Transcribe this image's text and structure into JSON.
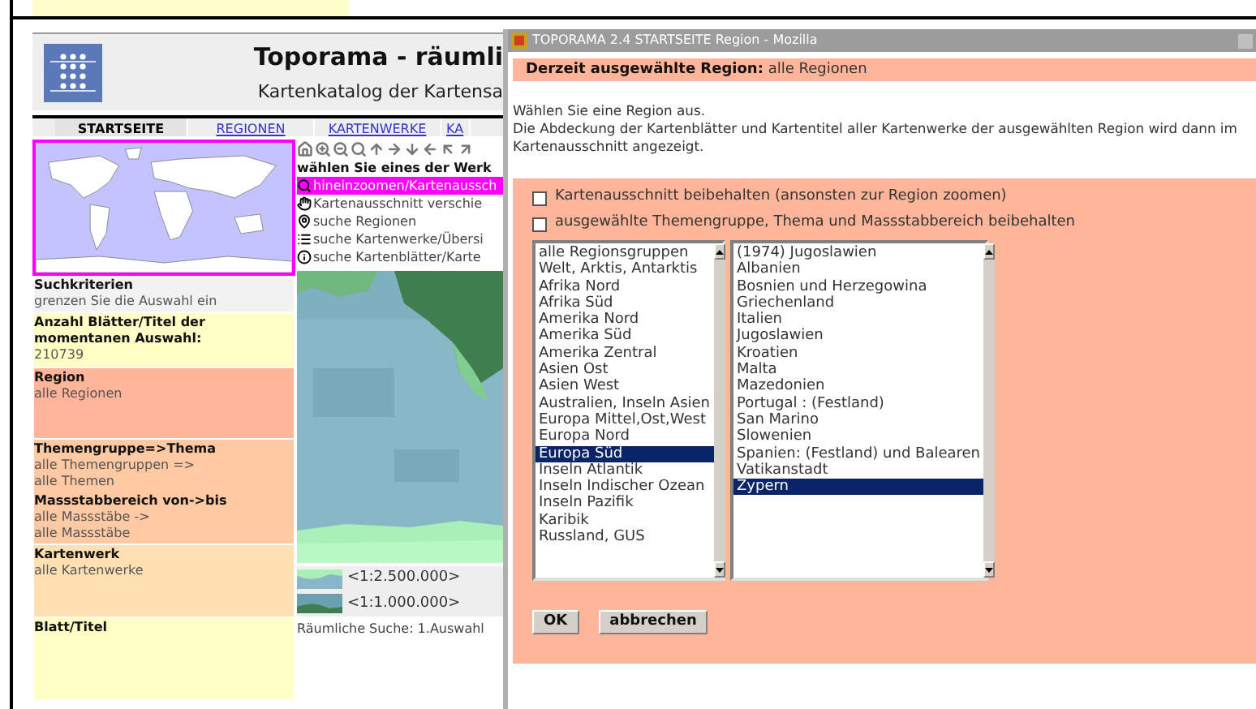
{
  "header": {
    "title": "Toporama - räumli",
    "subtitle": "Kartenkatalog der Kartensa"
  },
  "nav": [
    {
      "label": "STARTSEITE",
      "selected": true
    },
    {
      "label": "REGIONEN",
      "selected": false
    },
    {
      "label": "KARTENWERKE",
      "selected": false
    },
    {
      "label": "KA",
      "selected": false
    }
  ],
  "criteria": {
    "title": "Suchkriterien",
    "hint": "grenzen Sie die Auswahl ein",
    "count_label": "Anzahl Blätter/Titel der momentanen Auswahl:",
    "count": "210739",
    "sections": [
      {
        "color": "#ffb599",
        "items": [
          {
            "label": "Region",
            "values": [
              "alle Regionen"
            ]
          }
        ]
      },
      {
        "color": "#ffc9a3",
        "items": [
          {
            "label": "Themengruppe=>Thema",
            "values": [
              "alle Themengruppen =>",
              "alle Themen"
            ]
          },
          {
            "label": "Massstabbereich von->bis",
            "values": [
              "alle Massstäbe ->",
              "alle Massstäbe"
            ]
          }
        ]
      },
      {
        "color": "#ffe0b3",
        "items": [
          {
            "label": "Kartenwerk",
            "values": [
              "alle Kartenwerke"
            ]
          }
        ]
      },
      {
        "color": "#ffffc6",
        "items": [
          {
            "label": "Blatt/Titel"
          }
        ]
      }
    ]
  },
  "tools": {
    "heading": "wählen Sie eines der Werk",
    "items": [
      {
        "kind": "zoom",
        "label": "hineinzoomen/Kartenaussch",
        "selected": true
      },
      {
        "kind": "pan",
        "label": "Kartenausschnitt verschie",
        "selected": false
      },
      {
        "kind": "region",
        "label": "suche Regionen",
        "selected": false
      },
      {
        "kind": "list",
        "label": "suche Kartenwerke/Übersi",
        "selected": false
      },
      {
        "kind": "info",
        "label": "suche Kartenblätter/Karte",
        "selected": false
      }
    ]
  },
  "legend": [
    "<1:2.500.000>",
    "<1:1.000.000>"
  ],
  "map_status": "Räumliche Suche: 1.Auswahl",
  "dialog": {
    "title": "TOPORAMA 2.4 STARTSEITE Region - Mozilla",
    "current_label": "Derzeit ausgewählte Region:",
    "current_value": "alle Regionen",
    "intro": [
      "Wählen Sie eine Region aus.",
      "Die Abdeckung der Kartenblätter und Kartentitel aller Kartenwerke der ausgewählten Region wird dann im Kartenausschnitt angezeigt."
    ],
    "options": [
      {
        "label": "Kartenausschnitt beibehalten (ansonsten zur Region zoomen)",
        "checked": false
      },
      {
        "label": "ausgewählte Themengruppe, Thema und Massstabbereich beibehalten",
        "checked": false
      }
    ],
    "groups": [
      {
        "label": "alle Regionsgruppen",
        "selected": false
      },
      {
        "label": "Welt, Arktis, Antarktis",
        "selected": false
      },
      {
        "label": "Afrika Nord",
        "selected": false
      },
      {
        "label": "Afrika Süd",
        "selected": false
      },
      {
        "label": "Amerika Nord",
        "selected": false
      },
      {
        "label": "Amerika Süd",
        "selected": false
      },
      {
        "label": "Amerika Zentral",
        "selected": false
      },
      {
        "label": "Asien Ost",
        "selected": false
      },
      {
        "label": "Asien West",
        "selected": false
      },
      {
        "label": "Australien, Inseln Asien",
        "selected": false
      },
      {
        "label": "Europa Mittel,Ost,West",
        "selected": false
      },
      {
        "label": "Europa Nord",
        "selected": false
      },
      {
        "label": "Europa Süd",
        "selected": true
      },
      {
        "label": "Inseln Atlantik",
        "selected": false
      },
      {
        "label": "Inseln Indischer Ozean",
        "selected": false
      },
      {
        "label": "Inseln Pazifik",
        "selected": false
      },
      {
        "label": "Karibik",
        "selected": false
      },
      {
        "label": "Russland, GUS",
        "selected": false
      }
    ],
    "regions": [
      {
        "label": "(1974) Jugoslawien",
        "selected": false
      },
      {
        "label": "Albanien",
        "selected": false
      },
      {
        "label": "Bosnien und Herzegowina",
        "selected": false
      },
      {
        "label": "Griechenland",
        "selected": false
      },
      {
        "label": "Italien",
        "selected": false
      },
      {
        "label": "Jugoslawien",
        "selected": false
      },
      {
        "label": "Kroatien",
        "selected": false
      },
      {
        "label": "Malta",
        "selected": false
      },
      {
        "label": "Mazedonien",
        "selected": false
      },
      {
        "label": "Portugal : (Festland)",
        "selected": false
      },
      {
        "label": "San Marino",
        "selected": false
      },
      {
        "label": "Slowenien",
        "selected": false
      },
      {
        "label": "Spanien: (Festland) und Balearen",
        "selected": false
      },
      {
        "label": "Vatikanstadt",
        "selected": false
      },
      {
        "label": "Zypern",
        "selected": true
      }
    ],
    "buttons": [
      "OK",
      "abbrechen"
    ]
  }
}
